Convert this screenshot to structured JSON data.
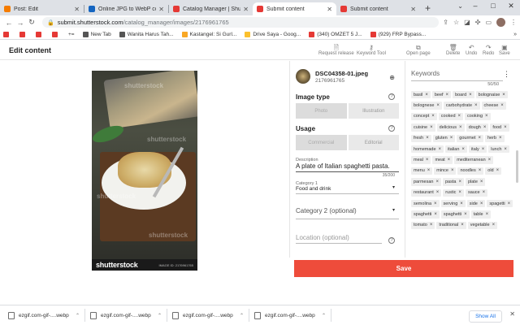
{
  "browser": {
    "tabs": [
      {
        "title": "Post: Edit",
        "color": "#f57c00"
      },
      {
        "title": "Online JPG to WebP converter",
        "color": "#1565c0"
      },
      {
        "title": "Catalog Manager | Shutterstock",
        "color": "#e53935"
      },
      {
        "title": "Submit content",
        "color": "#e53935"
      },
      {
        "title": "Submit content",
        "color": "#e53935"
      }
    ],
    "url_host": "submit.shutterstock.com",
    "url_path": "/catalog_manager/images/2176961765",
    "bookmarks": [
      {
        "label": "",
        "color": "#e53935"
      },
      {
        "label": "",
        "color": "#e53935"
      },
      {
        "label": "",
        "color": "#e53935"
      },
      {
        "label": "",
        "color": "#e53935"
      },
      {
        "label": "+="
      },
      {
        "label": "New Tab",
        "color": "#555555"
      },
      {
        "label": "Wanita Harus Tah...",
        "color": "#555555"
      },
      {
        "label": "Kastangel: Si Gurl...",
        "color": "#f9a825"
      },
      {
        "label": "Drive Saya - Goog...",
        "color": "#fbc02d"
      },
      {
        "label": "(340) OMZET 5 J...",
        "color": "#e53935"
      },
      {
        "label": "(929) FRP Bypass...",
        "color": "#e53935"
      }
    ]
  },
  "page": {
    "title": "Edit content",
    "actions": {
      "request_release": "Request release",
      "keyword_tool": "Keyword Tool",
      "open_page": "Open page",
      "delete": "Delete",
      "undo": "Undo",
      "redo": "Redo",
      "save": "Save"
    }
  },
  "preview": {
    "watermark": "shutterstock",
    "logo": "shutterstock",
    "image_id": "IMAGE ID: 2176961765"
  },
  "file": {
    "name": "DSC04358-01.jpeg",
    "id": "2176961765"
  },
  "form": {
    "image_type_label": "Image type",
    "image_type_options": [
      "Photo",
      "Illustration"
    ],
    "usage_label": "Usage",
    "usage_options": [
      "Commercial",
      "Editorial"
    ],
    "description_label": "Description",
    "description_value": "A plate of Italian spaghetti pasta.",
    "description_count": "35/200",
    "category1_label": "Category 1",
    "category1_value": "Food and drink",
    "category2_placeholder": "Category 2 (optional)",
    "location_placeholder": "Location (optional)"
  },
  "keywords": {
    "title": "Keywords",
    "count": "50/50",
    "items": [
      "basil",
      "beef",
      "board",
      "bolognaise",
      "bolognese",
      "carbohydrate",
      "cheese",
      "concept",
      "cooked",
      "cooking",
      "cuisine",
      "delicious",
      "dough",
      "food",
      "fresh",
      "gluten",
      "gourmet",
      "herb",
      "homemade",
      "italian",
      "italy",
      "lunch",
      "meal",
      "meat",
      "mediterranean",
      "menu",
      "mince",
      "noodles",
      "old",
      "parmesan",
      "pasta",
      "plate",
      "restaurant",
      "rustic",
      "sauce",
      "semolina",
      "serving",
      "side",
      "spagetti",
      "spaghetti",
      "spaghetti",
      "table",
      "tomato",
      "traditional",
      "vegetable"
    ]
  },
  "save_label": "Save",
  "downloads": {
    "items": [
      "ezgif.com-gif-....webp",
      "ezgif.com-gif-....webp",
      "ezgif.com-gif-....webp",
      "ezgif.com-gif-....webp"
    ],
    "show_all": "Show All"
  }
}
